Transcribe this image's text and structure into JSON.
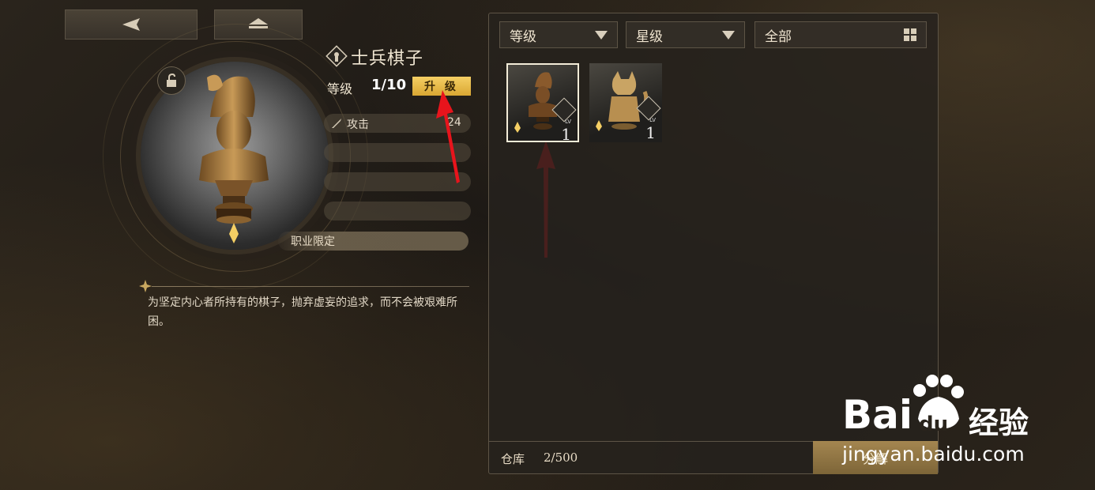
{
  "item": {
    "name": "士兵棋子",
    "level_label": "等级",
    "level_value": "1/10",
    "upgrade_label": "升 级",
    "stats": [
      {
        "label": "攻击",
        "value": "24"
      }
    ],
    "job_label": "职业限定",
    "description": "为坚定内心者所持有的棋子，抛弃虚妄的追求，而不会被艰难所困。"
  },
  "filters": [
    {
      "label": "等级"
    },
    {
      "label": "星级"
    },
    {
      "label": "全部"
    }
  ],
  "inventory": {
    "cards": [
      {
        "lv_label": "LV",
        "level": "1",
        "selected": true,
        "figure": "soldier"
      },
      {
        "lv_label": "LV",
        "level": "1",
        "selected": false,
        "figure": "cat"
      }
    ],
    "storage_label": "仓库",
    "storage_value": "2/500",
    "decompose_label": "分解"
  },
  "watermark": {
    "brand": "Bai",
    "du": "du",
    "jingyan": "经验",
    "url": "jingyan.baidu.com"
  },
  "colors": {
    "accent_gold": "#f5cf64",
    "annotation_red": "#e8141c"
  }
}
